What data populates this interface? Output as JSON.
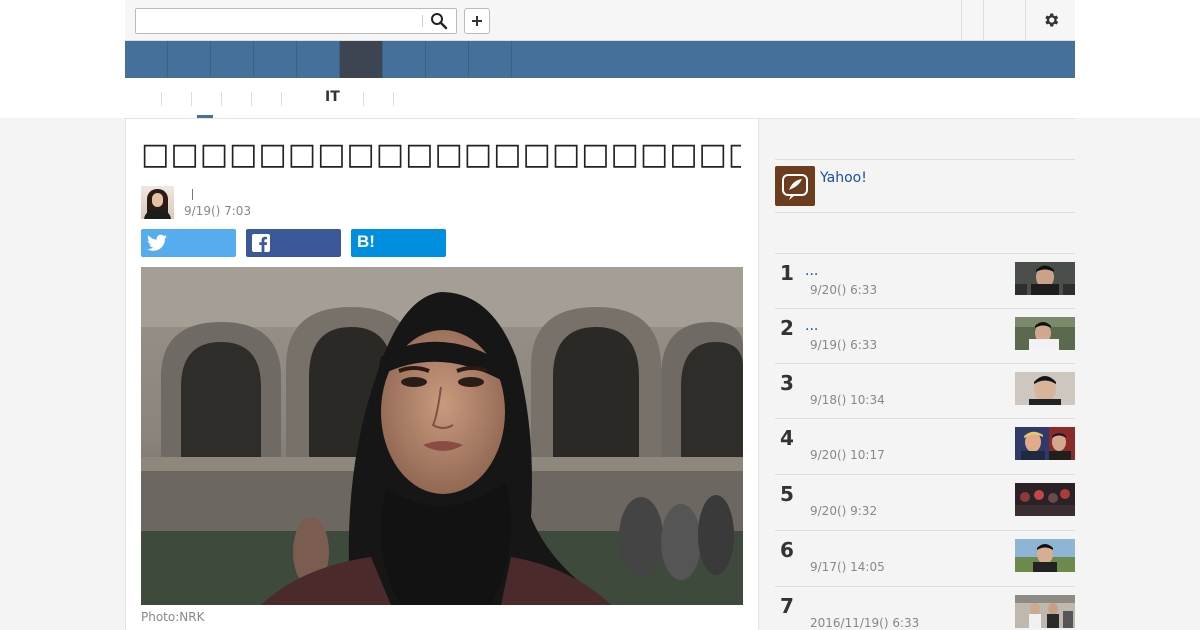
{
  "header": {
    "search_placeholder": "",
    "search_value": ""
  },
  "subnav": {
    "items": [
      {
        "label": ""
      },
      {
        "label": ""
      },
      {
        "label": ""
      },
      {
        "label": ""
      },
      {
        "label": ""
      },
      {
        "label": "IT"
      },
      {
        "label": ""
      }
    ]
  },
  "article": {
    "title": "□□□□□□□□□□□□□□□□□□□□□□□□□□□□□□□□□□□□□",
    "author_separator": "|",
    "date": "9/19() 7:03",
    "photo_credit": "Photo:NRK",
    "hatena_label": "B!"
  },
  "sidebar": {
    "yahoo_label": "Yahoo!",
    "ranking": [
      {
        "rank": "1",
        "title": "...",
        "date": "9/20() 6:33"
      },
      {
        "rank": "2",
        "title": "...",
        "date": "9/19() 6:33"
      },
      {
        "rank": "3",
        "title": "",
        "date": "9/18() 10:34"
      },
      {
        "rank": "4",
        "title": "",
        "date": "9/20() 10:17"
      },
      {
        "rank": "5",
        "title": "",
        "date": "9/20() 9:32"
      },
      {
        "rank": "6",
        "title": "",
        "date": "9/17() 14:05"
      },
      {
        "rank": "7",
        "title": "",
        "date": "2016/11/19() 6:33"
      }
    ]
  },
  "colors": {
    "nav_blue": "#44709a",
    "nav_active": "#3d4553",
    "twitter": "#55acee",
    "facebook": "#3b5998",
    "hatena": "#008fde",
    "link": "#1a4fa0"
  }
}
